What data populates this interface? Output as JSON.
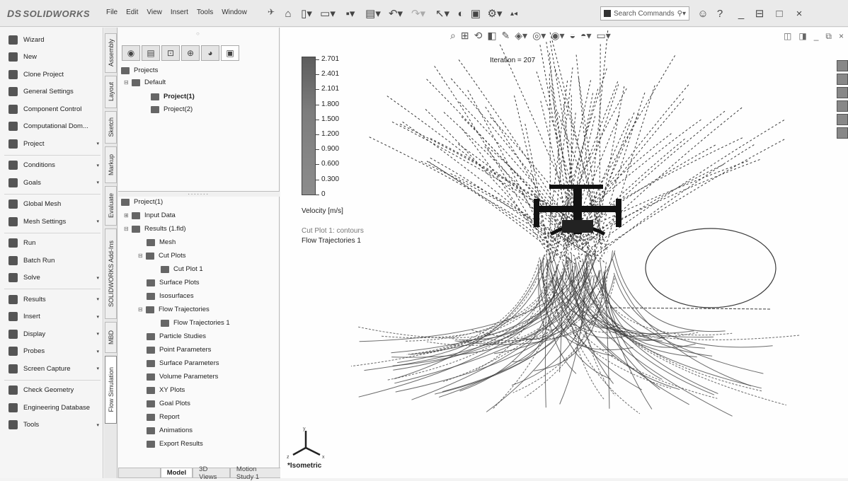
{
  "app": {
    "logo_prefix": "DS",
    "logo_name": "SOLIDWORKS"
  },
  "menu": [
    "File",
    "Edit",
    "View",
    "Insert",
    "Tools",
    "Window"
  ],
  "search": {
    "placeholder": "Search Commands"
  },
  "commands": [
    {
      "label": "Wizard",
      "icon": "wand-icon",
      "arrow": false
    },
    {
      "label": "New",
      "icon": "new-doc-icon",
      "arrow": false
    },
    {
      "label": "Clone Project",
      "icon": "clone-icon",
      "arrow": false
    },
    {
      "label": "General Settings",
      "icon": "settings-icon",
      "arrow": false
    },
    {
      "label": "Component Control",
      "icon": "component-icon",
      "arrow": false
    },
    {
      "label": "Computational Dom...",
      "icon": "domain-icon",
      "arrow": false
    },
    {
      "label": "Project",
      "icon": "project-icon",
      "arrow": true
    },
    {
      "label": "Conditions",
      "icon": "conditions-icon",
      "arrow": true
    },
    {
      "label": "Goals",
      "icon": "goals-icon",
      "arrow": true
    },
    {
      "label": "Global Mesh",
      "icon": "mesh-icon",
      "arrow": false
    },
    {
      "label": "Mesh Settings",
      "icon": "mesh-settings-icon",
      "arrow": true
    },
    {
      "label": "Run",
      "icon": "run-icon",
      "arrow": false
    },
    {
      "label": "Batch Run",
      "icon": "batch-run-icon",
      "arrow": false
    },
    {
      "label": "Solve",
      "icon": "solve-icon",
      "arrow": true
    },
    {
      "label": "Results",
      "icon": "results-icon",
      "arrow": true
    },
    {
      "label": "Insert",
      "icon": "insert-icon",
      "arrow": true
    },
    {
      "label": "Display",
      "icon": "display-icon",
      "arrow": true
    },
    {
      "label": "Probes",
      "icon": "probes-icon",
      "arrow": true
    },
    {
      "label": "Screen Capture",
      "icon": "camera-icon",
      "arrow": true
    },
    {
      "label": "Check Geometry",
      "icon": "check-geometry-icon",
      "arrow": false
    },
    {
      "label": "Engineering Database",
      "icon": "database-icon",
      "arrow": false
    },
    {
      "label": "Tools",
      "icon": "tools-icon",
      "arrow": true
    }
  ],
  "vertical_tabs": [
    "Assembly",
    "Layout",
    "Sketch",
    "Markup",
    "Evaluate",
    "SOLIDWORKS Add-Ins",
    "MBD",
    "Flow Simulation"
  ],
  "projects_tree": {
    "root": "Projects",
    "config": "Default",
    "items": [
      "Project(1)",
      "Project(2)"
    ]
  },
  "analysis_tree": {
    "root": "Project(1)",
    "input": "Input Data",
    "results": "Results (1.fld)",
    "mesh": "Mesh",
    "cut_plots": "Cut Plots",
    "cut_plot_1": "Cut Plot 1",
    "surface_plots": "Surface Plots",
    "isosurfaces": "Isosurfaces",
    "flow_trajectories": "Flow Trajectories",
    "flow_trajectories_1": "Flow Trajectories 1",
    "particle_studies": "Particle Studies",
    "point_parameters": "Point Parameters",
    "surface_parameters": "Surface Parameters",
    "volume_parameters": "Volume Parameters",
    "xy_plots": "XY Plots",
    "goal_plots": "Goal Plots",
    "report": "Report",
    "animations": "Animations",
    "export_results": "Export Results"
  },
  "bottom_tabs": [
    "Model",
    "3D Views",
    "Motion Study 1"
  ],
  "viewport": {
    "legend_values": [
      "2.701",
      "2.401",
      "2.101",
      "1.800",
      "1.500",
      "1.200",
      "0.900",
      "0.600",
      "0.300",
      "0"
    ],
    "legend_title": "Velocity [m/s]",
    "cut_plot_label": "Cut Plot 1: contours",
    "flow_label": "Flow Trajectories 1",
    "iteration": "Iteration = 207",
    "view_label": "*Isometric",
    "triad_labels": [
      "y",
      "z",
      "x"
    ]
  },
  "colors": {
    "legend_dark": "#5d5d5d",
    "trajectory": "#3a3a3a",
    "background": "#fefefe"
  }
}
